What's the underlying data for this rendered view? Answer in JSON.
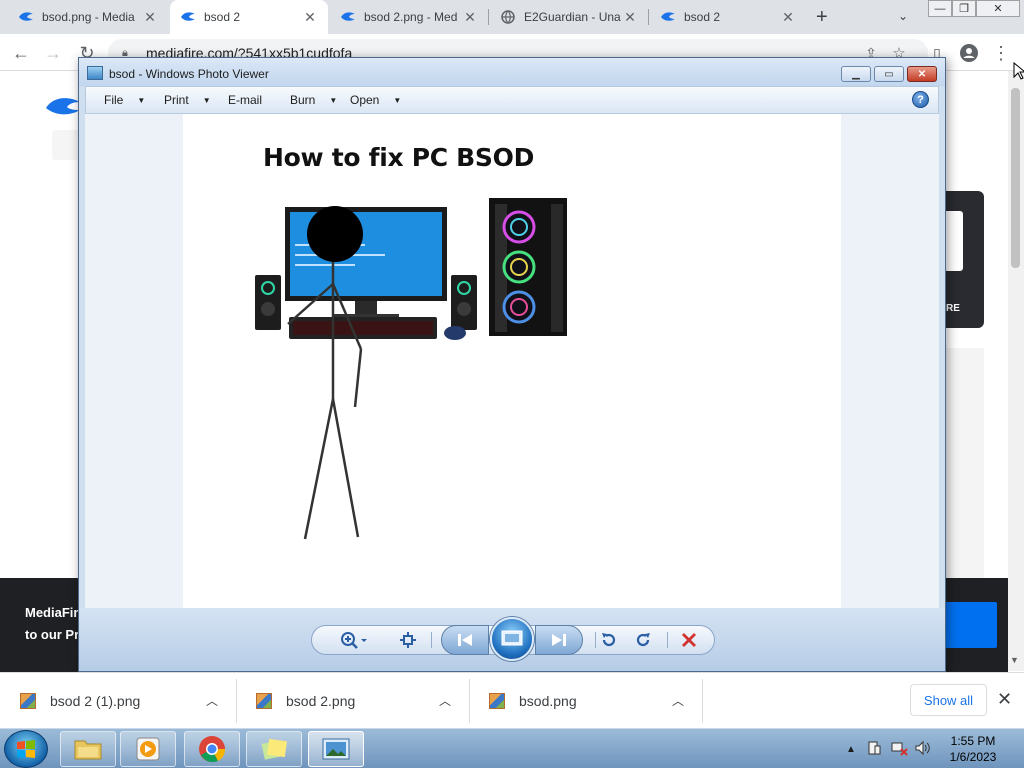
{
  "browser": {
    "tabs": [
      {
        "title": "bsod.png - Media",
        "active": false
      },
      {
        "title": "bsod 2",
        "active": true
      },
      {
        "title": "bsod 2.png - Med",
        "active": false
      },
      {
        "title": "E2Guardian - Una",
        "active": false
      },
      {
        "title": "bsod 2",
        "active": false
      }
    ],
    "url": "mediafire.com/?541xx5b1cudfofa"
  },
  "page": {
    "cookie_line1": "MediaFire",
    "cookie_line2": "to our Pri",
    "card_label": "RE"
  },
  "photo_viewer": {
    "title": "bsod - Windows Photo Viewer",
    "menu": [
      {
        "label": "File",
        "has_dropdown": true
      },
      {
        "label": "Print",
        "has_dropdown": true
      },
      {
        "label": "E-mail",
        "has_dropdown": false
      },
      {
        "label": "Burn",
        "has_dropdown": true
      },
      {
        "label": "Open",
        "has_dropdown": true
      }
    ],
    "photo_heading": "How to fix PC BSOD"
  },
  "downloads": {
    "items": [
      {
        "filename": "bsod 2 (1).png"
      },
      {
        "filename": "bsod 2.png"
      },
      {
        "filename": "bsod.png"
      }
    ],
    "show_all": "Show all"
  },
  "taskbar": {
    "time": "1:55 PM",
    "date": "1/6/2023"
  },
  "colors": {
    "accent": "#1a73e8",
    "tab_strip": "#dee1e6",
    "cookie_bar": "#1f2023",
    "close_red": "#c33c25"
  }
}
